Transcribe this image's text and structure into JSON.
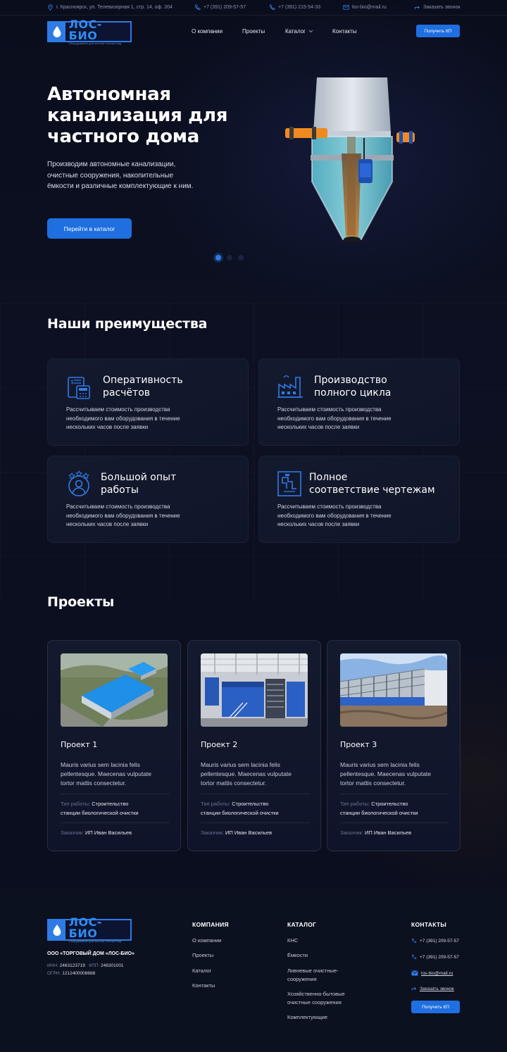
{
  "colors": {
    "accent": "#2f7be6",
    "background": "#0b0e1e",
    "card": "#141a2e"
  },
  "topbar": {
    "address": "г. Красноярск, ул. Телевизорная 1, стр. 14, оф. 204",
    "phone1": "+7 (391) 209-57-57",
    "phone2": "+7 (391) 215-54-33",
    "email": "los-bio@mail.ru",
    "callback": "Заказать звонок"
  },
  "logo": {
    "name": "ЛОС-БИО",
    "tagline": "Оборудование для очистки сточных вод"
  },
  "nav": {
    "about": "О компании",
    "projects": "Проекты",
    "catalog": "Каталог",
    "contacts": "Контакты"
  },
  "header": {
    "cta": "Получить КП"
  },
  "hero": {
    "title_lines": [
      "Автономная",
      "канализация для",
      "частного дома"
    ],
    "desc_lines": [
      "Производим автономные канализации,",
      "очистные сооружения, накопительные",
      "ёмкости и различные комплектующие к ним."
    ],
    "button": "Перейти в каталог",
    "slides_total": 3,
    "slide_active": 1
  },
  "advantages": {
    "title": "Наши преимущества",
    "items": [
      {
        "icon": "calculator-icon",
        "title_lines": [
          "Оперативность",
          "расчётов"
        ],
        "text_lines": [
          "Рассчитываем стоимость производства",
          "необходимого вам оборудования в течение",
          "нескольких часов после заявки"
        ]
      },
      {
        "icon": "factory-icon",
        "title_lines": [
          "Производство",
          "полного цикла"
        ],
        "text_lines": [
          "Рассчитываем стоимость производства",
          "необходимого вам оборудования в течение",
          "нескольких часов после заявки"
        ]
      },
      {
        "icon": "expert-icon",
        "title_lines": [
          "Большой опыт",
          "работы"
        ],
        "text_lines": [
          "Рассчитываем стоимость производства",
          "необходимого вам оборудования в течение",
          "нескольких часов после заявки"
        ]
      },
      {
        "icon": "blueprint-icon",
        "title_lines": [
          "Полное",
          "соответствие чертежам"
        ],
        "text_lines": [
          "Рассчитываем стоимость производства",
          "необходимого вам оборудования в течение",
          "нескольких часов после заявки"
        ]
      }
    ]
  },
  "projects": {
    "title": "Проекты",
    "work_type_label": "Тип работы:",
    "customer_label": "Заказчик:",
    "items": [
      {
        "name": "Проект 1",
        "desc_lines": [
          "Mauris varius sem lacinia felis",
          "pellentesque. Maecenas vulputate",
          "tortor mattis consectetur."
        ],
        "work_type_lines": [
          "Строительство",
          "станции биологической очистки"
        ],
        "customer": "ИП Иван Васильев"
      },
      {
        "name": "Проект 2",
        "desc_lines": [
          "Mauris varius sem lacinia felis",
          "pellentesque. Maecenas vulputate",
          "tortor mattis consectetur."
        ],
        "work_type_lines": [
          "Строительство",
          "станции биологической очистки"
        ],
        "customer": "ИП Иван Васильев"
      },
      {
        "name": "Проект 3",
        "desc_lines": [
          "Mauris varius sem lacinia felis",
          "pellentesque. Maecenas vulputate",
          "tortor mattis consectetur."
        ],
        "work_type_lines": [
          "Строительство",
          "станции биологической очистки"
        ],
        "customer": "ИП Иван Васильев"
      }
    ]
  },
  "footer": {
    "company_name": "ООО «ТОРГОВЫЙ ДОМ «ЛОС-БИО»",
    "inn_label": "ИНН:",
    "inn": "2463123719",
    "kpp_label": "КПП:",
    "kpp": "246301001",
    "ogrn_label": "ОГРН:",
    "ogrn": "1212400008688",
    "company_head": "КОМПАНИЯ",
    "company_links": [
      "О компании",
      "Проекты",
      "Каталог",
      "Контакты"
    ],
    "catalog_head": "КАТАЛОГ",
    "catalog_links": [
      "КНС",
      "Ёмкости",
      "Ливневые очистные-сооружения",
      "Хозяйственно-бытовые очистные сооружения",
      "Комплектующие"
    ],
    "contacts_head": "КОНТАКТЫ",
    "phone1": "+7 (391) 209-57-57",
    "phone2": "+7 (391) 209-57-57",
    "email": "los-bio@mail.ru",
    "callback": "Заказать звонок",
    "cta": "Получить КП"
  }
}
